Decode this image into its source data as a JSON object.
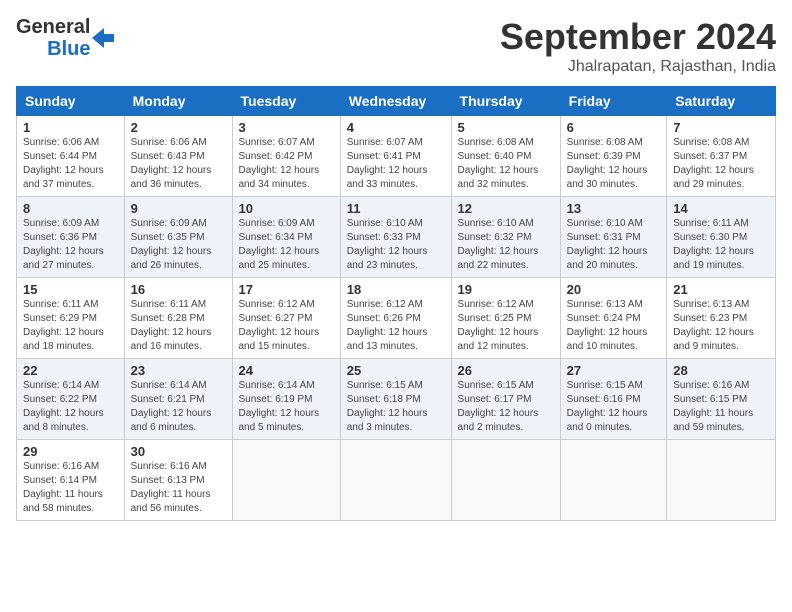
{
  "logo": {
    "line1": "General",
    "line2": "Blue"
  },
  "title": "September 2024",
  "subtitle": "Jhalrapatan, Rajasthan, India",
  "columns": [
    "Sunday",
    "Monday",
    "Tuesday",
    "Wednesday",
    "Thursday",
    "Friday",
    "Saturday"
  ],
  "weeks": [
    [
      {
        "day": "1",
        "info": "Sunrise: 6:06 AM\nSunset: 6:44 PM\nDaylight: 12 hours\nand 37 minutes."
      },
      {
        "day": "2",
        "info": "Sunrise: 6:06 AM\nSunset: 6:43 PM\nDaylight: 12 hours\nand 36 minutes."
      },
      {
        "day": "3",
        "info": "Sunrise: 6:07 AM\nSunset: 6:42 PM\nDaylight: 12 hours\nand 34 minutes."
      },
      {
        "day": "4",
        "info": "Sunrise: 6:07 AM\nSunset: 6:41 PM\nDaylight: 12 hours\nand 33 minutes."
      },
      {
        "day": "5",
        "info": "Sunrise: 6:08 AM\nSunset: 6:40 PM\nDaylight: 12 hours\nand 32 minutes."
      },
      {
        "day": "6",
        "info": "Sunrise: 6:08 AM\nSunset: 6:39 PM\nDaylight: 12 hours\nand 30 minutes."
      },
      {
        "day": "7",
        "info": "Sunrise: 6:08 AM\nSunset: 6:37 PM\nDaylight: 12 hours\nand 29 minutes."
      }
    ],
    [
      {
        "day": "8",
        "info": "Sunrise: 6:09 AM\nSunset: 6:36 PM\nDaylight: 12 hours\nand 27 minutes."
      },
      {
        "day": "9",
        "info": "Sunrise: 6:09 AM\nSunset: 6:35 PM\nDaylight: 12 hours\nand 26 minutes."
      },
      {
        "day": "10",
        "info": "Sunrise: 6:09 AM\nSunset: 6:34 PM\nDaylight: 12 hours\nand 25 minutes."
      },
      {
        "day": "11",
        "info": "Sunrise: 6:10 AM\nSunset: 6:33 PM\nDaylight: 12 hours\nand 23 minutes."
      },
      {
        "day": "12",
        "info": "Sunrise: 6:10 AM\nSunset: 6:32 PM\nDaylight: 12 hours\nand 22 minutes."
      },
      {
        "day": "13",
        "info": "Sunrise: 6:10 AM\nSunset: 6:31 PM\nDaylight: 12 hours\nand 20 minutes."
      },
      {
        "day": "14",
        "info": "Sunrise: 6:11 AM\nSunset: 6:30 PM\nDaylight: 12 hours\nand 19 minutes."
      }
    ],
    [
      {
        "day": "15",
        "info": "Sunrise: 6:11 AM\nSunset: 6:29 PM\nDaylight: 12 hours\nand 18 minutes."
      },
      {
        "day": "16",
        "info": "Sunrise: 6:11 AM\nSunset: 6:28 PM\nDaylight: 12 hours\nand 16 minutes."
      },
      {
        "day": "17",
        "info": "Sunrise: 6:12 AM\nSunset: 6:27 PM\nDaylight: 12 hours\nand 15 minutes."
      },
      {
        "day": "18",
        "info": "Sunrise: 6:12 AM\nSunset: 6:26 PM\nDaylight: 12 hours\nand 13 minutes."
      },
      {
        "day": "19",
        "info": "Sunrise: 6:12 AM\nSunset: 6:25 PM\nDaylight: 12 hours\nand 12 minutes."
      },
      {
        "day": "20",
        "info": "Sunrise: 6:13 AM\nSunset: 6:24 PM\nDaylight: 12 hours\nand 10 minutes."
      },
      {
        "day": "21",
        "info": "Sunrise: 6:13 AM\nSunset: 6:23 PM\nDaylight: 12 hours\nand 9 minutes."
      }
    ],
    [
      {
        "day": "22",
        "info": "Sunrise: 6:14 AM\nSunset: 6:22 PM\nDaylight: 12 hours\nand 8 minutes."
      },
      {
        "day": "23",
        "info": "Sunrise: 6:14 AM\nSunset: 6:21 PM\nDaylight: 12 hours\nand 6 minutes."
      },
      {
        "day": "24",
        "info": "Sunrise: 6:14 AM\nSunset: 6:19 PM\nDaylight: 12 hours\nand 5 minutes."
      },
      {
        "day": "25",
        "info": "Sunrise: 6:15 AM\nSunset: 6:18 PM\nDaylight: 12 hours\nand 3 minutes."
      },
      {
        "day": "26",
        "info": "Sunrise: 6:15 AM\nSunset: 6:17 PM\nDaylight: 12 hours\nand 2 minutes."
      },
      {
        "day": "27",
        "info": "Sunrise: 6:15 AM\nSunset: 6:16 PM\nDaylight: 12 hours\nand 0 minutes."
      },
      {
        "day": "28",
        "info": "Sunrise: 6:16 AM\nSunset: 6:15 PM\nDaylight: 11 hours\nand 59 minutes."
      }
    ],
    [
      {
        "day": "29",
        "info": "Sunrise: 6:16 AM\nSunset: 6:14 PM\nDaylight: 11 hours\nand 58 minutes."
      },
      {
        "day": "30",
        "info": "Sunrise: 6:16 AM\nSunset: 6:13 PM\nDaylight: 11 hours\nand 56 minutes."
      },
      {
        "day": "",
        "info": ""
      },
      {
        "day": "",
        "info": ""
      },
      {
        "day": "",
        "info": ""
      },
      {
        "day": "",
        "info": ""
      },
      {
        "day": "",
        "info": ""
      }
    ]
  ]
}
